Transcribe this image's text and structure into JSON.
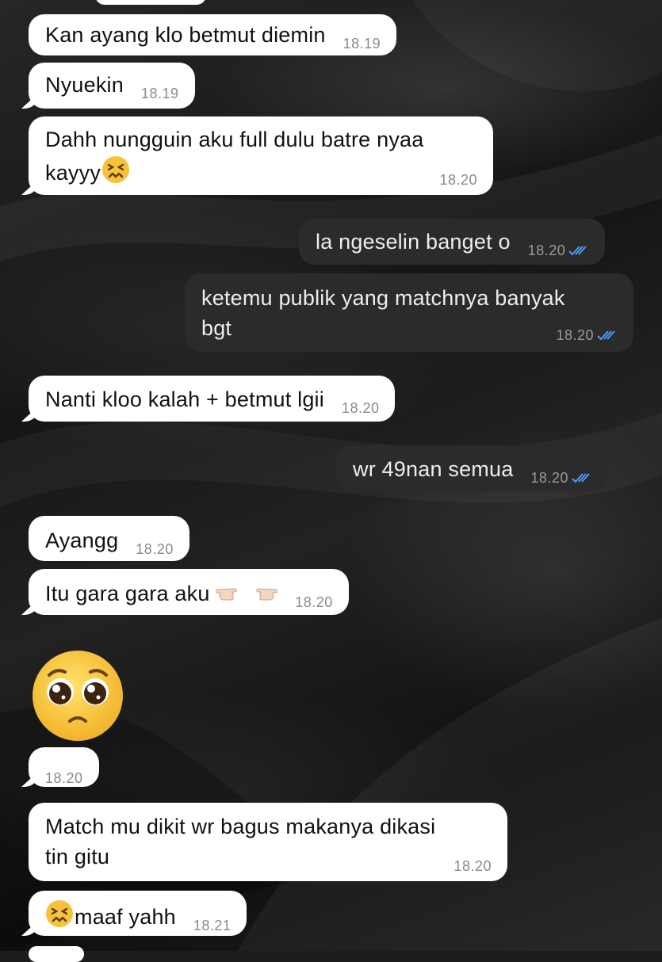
{
  "chat": {
    "messages": [
      {
        "dir": "in",
        "text": "Kan ayang klo betmut diemin",
        "time": "18.19"
      },
      {
        "dir": "in",
        "text": "Nyuekin",
        "time": "18.19"
      },
      {
        "dir": "in",
        "text": "Dahh nungguin aku full dulu batre nyaa",
        "text2": "kayyy",
        "emoji": "confounded-face",
        "time": "18.20"
      },
      {
        "dir": "out",
        "text": "la ngeselin banget o",
        "time": "18.20",
        "status": "read"
      },
      {
        "dir": "out",
        "text": "ketemu publik yang matchnya banyak",
        "text2": "bgt",
        "time": "18.20",
        "status": "read"
      },
      {
        "dir": "in",
        "text": "Nanti kloo kalah + betmut lgii",
        "time": "18.20"
      },
      {
        "dir": "out",
        "text": "wr 49nan semua",
        "time": "18.20",
        "status": "read"
      },
      {
        "dir": "in",
        "text": "Ayangg",
        "time": "18.20"
      },
      {
        "dir": "in",
        "text": "Itu gara gara aku",
        "emoji": "index-fingers-pointing",
        "time": "18.20"
      },
      {
        "dir": "in",
        "emoji": "pleading-face",
        "time": "18.20"
      },
      {
        "dir": "in",
        "text": "Match mu dikit wr bagus makanya dikasi",
        "text2": "tin gitu",
        "time": "18.20"
      },
      {
        "dir": "in",
        "text": "maaf yahh",
        "emoji": "confounded-face",
        "time": "18.21"
      }
    ]
  },
  "colors": {
    "incoming_bubble": "#ffffff",
    "outgoing_bubble": "#2b2b2b",
    "read_check": "#4a9cf6"
  }
}
